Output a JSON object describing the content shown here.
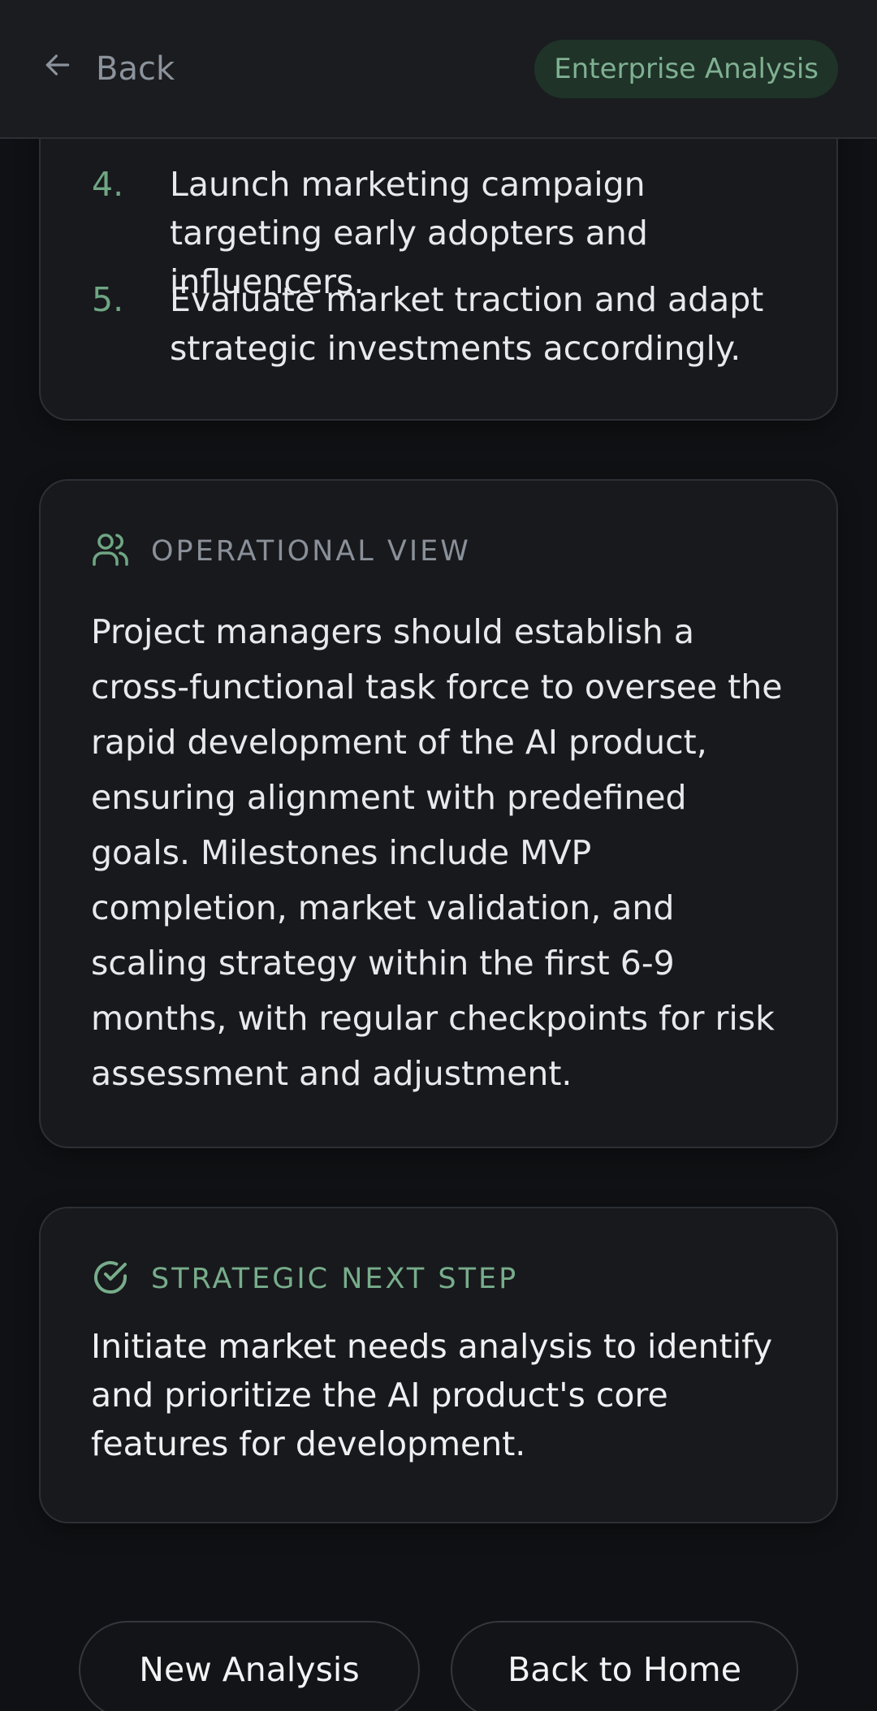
{
  "header": {
    "back_label": "Back",
    "badge": "Enterprise Analysis",
    "back_icon": "arrow-left-icon"
  },
  "action_steps": [
    {
      "number": "4.",
      "text": "Launch marketing campaign targeting early adopters and influencers."
    },
    {
      "number": "5.",
      "text": "Evaluate market traction and adapt strategic investments accordingly."
    }
  ],
  "operational_view": {
    "icon": "users-icon",
    "title": "OPERATIONAL VIEW",
    "body": "Project managers should establish a cross-functional task force to oversee the rapid development of the AI product, ensuring alignment with predefined goals. Milestones include MVP completion, market validation, and scaling strategy within the first 6-9 months, with regular checkpoints for risk assessment and adjustment."
  },
  "strategic_next_step": {
    "icon": "check-circle-icon",
    "title": "STRATEGIC NEXT STEP",
    "body": "Initiate market needs analysis to identify and prioritize the AI product's core features for development."
  },
  "buttons": {
    "new_analysis": "New Analysis",
    "back_to_home": "Back to Home"
  },
  "colors": {
    "background": "#0f1114",
    "card": "#18191c",
    "accent_green": "#77ad8b",
    "badge_bg": "#1f3328"
  }
}
